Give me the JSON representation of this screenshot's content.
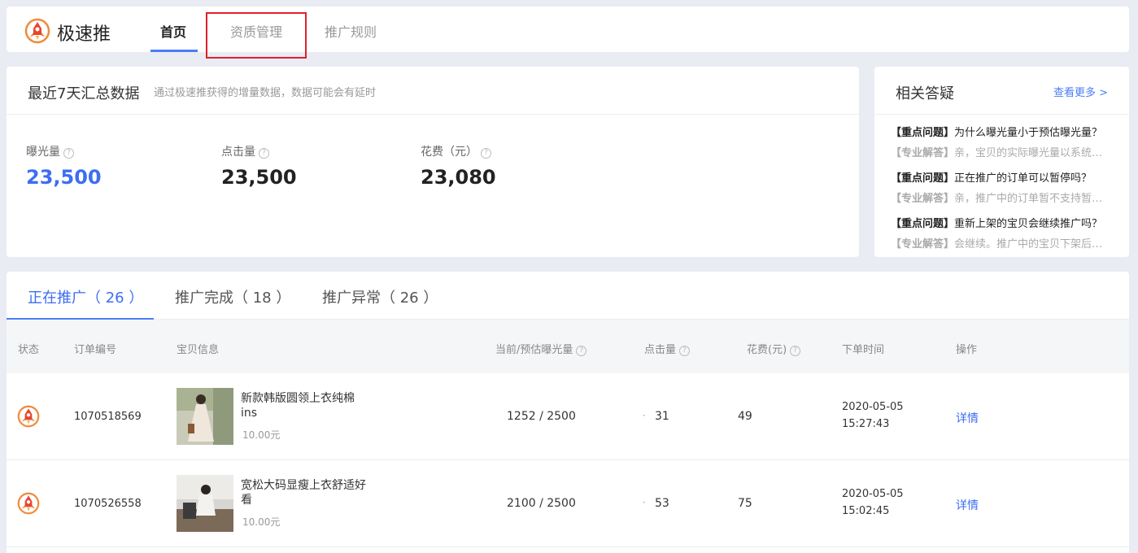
{
  "nav": {
    "brand": "极速推",
    "tabs": [
      {
        "label": "首页"
      },
      {
        "label": "资质管理"
      },
      {
        "label": "推广规则"
      }
    ]
  },
  "summary": {
    "title": "最近7天汇总数据",
    "subtitle": "通过极速推获得的增量数据，数据可能会有延时",
    "metrics": [
      {
        "label": "曝光量",
        "value": "23,500"
      },
      {
        "label": "点击量",
        "value": "23,500"
      },
      {
        "label": "花费（元）",
        "value": "23,080"
      }
    ]
  },
  "faq": {
    "title": "相关答疑",
    "more": "查看更多 >",
    "items": [
      {
        "q_tag": "【重点问题】",
        "q": "为什么曝光量小于预估曝光量？",
        "a_tag": "【专业解答】",
        "a": "亲，宝贝的实际曝光量以系统…"
      },
      {
        "q_tag": "【重点问题】",
        "q": "正在推广的订单可以暂停吗？",
        "a_tag": "【专业解答】",
        "a": "亲，推广中的订单暂不支持暂…"
      },
      {
        "q_tag": "【重点问题】",
        "q": "重新上架的宝贝会继续推广吗？",
        "a_tag": "【专业解答】",
        "a": "会继续。推广中的宝贝下架后…"
      }
    ]
  },
  "table": {
    "tabs": [
      {
        "label": "正在推广（ 26 ）"
      },
      {
        "label": "推广完成（ 18 ）"
      },
      {
        "label": "推广异常（ 26 ）"
      }
    ],
    "headers": {
      "status": "状态",
      "order_no": "订单编号",
      "item_info": "宝贝信息",
      "exposure": "当前/预估曝光量",
      "clicks": "点击量",
      "cost": "花费(元)",
      "order_time": "下单时间",
      "action": "操作"
    },
    "rows": [
      {
        "order_no": "1070518569",
        "item_name": "新款韩版圆领上衣纯棉ins",
        "price": "10.00元",
        "exposure": "1252 / 2500",
        "clicks": "31",
        "cost": "49",
        "date": "2020-05-05",
        "time": "15:27:43",
        "action": "详情"
      },
      {
        "order_no": "1070526558",
        "item_name": "宽松大码显瘦上衣舒适好看",
        "price": "10.00元",
        "exposure": "2100 / 2500",
        "clicks": "53",
        "cost": "75",
        "date": "2020-05-05",
        "time": "15:02:45",
        "action": "详情"
      }
    ]
  },
  "colors": {
    "accent": "#4a7ef6",
    "highlight_box": "#e0202a",
    "page_bg": "#e9ecf3"
  },
  "icons": {
    "brand_logo": "rocket-logo-icon",
    "help": "question-circle-icon"
  }
}
